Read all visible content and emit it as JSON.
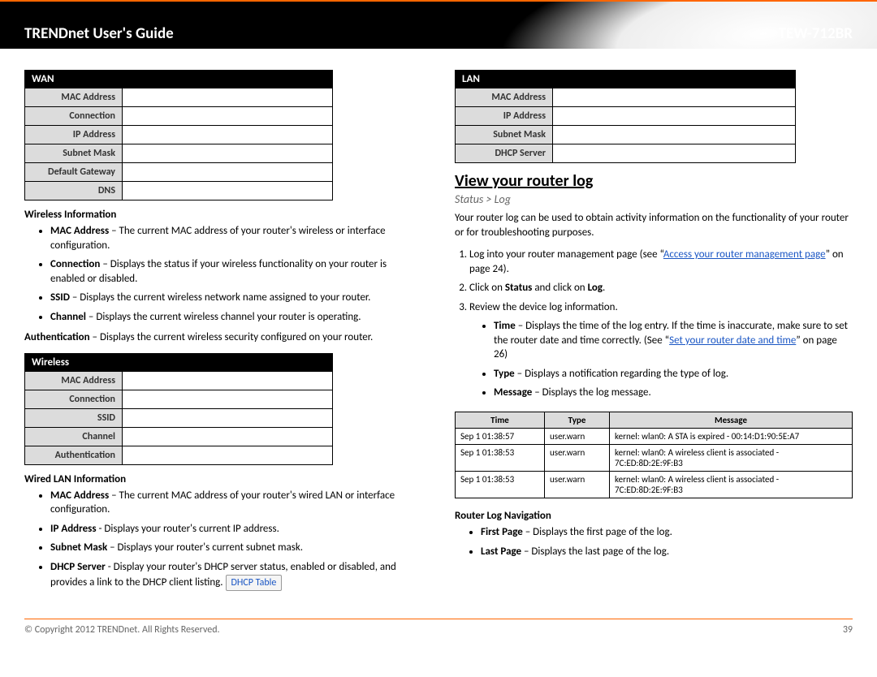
{
  "header": {
    "left": "TRENDnet User's Guide",
    "right": "TEW-712BR"
  },
  "left": {
    "wan_table": {
      "title": "WAN",
      "rows": [
        "MAC Address",
        "Connection",
        "IP Address",
        "Subnet Mask",
        "Default Gateway",
        "DNS"
      ]
    },
    "wireless_info": {
      "heading": "Wireless Information",
      "items": [
        {
          "label": "MAC Address",
          "text": " – The current MAC address of your router's wireless or interface configuration."
        },
        {
          "label": "Connection",
          "text": " – Displays the status if your wireless functionality on your router is enabled or disabled."
        },
        {
          "label": "SSID",
          "text": " – Displays the current wireless network name assigned to your router."
        },
        {
          "label": "Channel",
          "text": " – Displays the current wireless channel your router is operating."
        }
      ],
      "auth_label": "Authentication",
      "auth_text": " – Displays the current wireless security configured on your router."
    },
    "wireless_table": {
      "title": "Wireless",
      "rows": [
        "MAC Address",
        "Connection",
        "SSID",
        "Channel",
        "Authentication"
      ]
    },
    "wired_info": {
      "heading": "Wired LAN Information",
      "items": [
        {
          "label": "MAC Address",
          "text": " – The current MAC address of your router's wired LAN or interface configuration."
        },
        {
          "label": "IP Address",
          "text": " - Displays your router's current IP address."
        },
        {
          "label": "Subnet Mask",
          "text": " – Displays your router's current subnet mask."
        },
        {
          "label": "DHCP Server",
          "text": " - Display your router's DHCP server status, enabled or disabled, and provides a link to the DHCP client listing.  ",
          "chip": "DHCP Table"
        }
      ]
    }
  },
  "right": {
    "lan_table": {
      "title": "LAN",
      "rows": [
        "MAC Address",
        "IP Address",
        "Subnet Mask",
        "DHCP Server"
      ]
    },
    "section_title": "View your router log",
    "crumb": "Status > Log",
    "intro": "Your router log can be used to obtain activity information on the functionality of your router or for troubleshooting purposes.",
    "steps": {
      "s1_pre": "Log into your router management page (see “",
      "s1_link": "Access your router management page",
      "s1_post": "” on page 24).",
      "s2_a": "Click on ",
      "s2_b": "Status",
      "s2_c": " and click on ",
      "s2_d": "Log",
      "s2_e": ".",
      "s3": "Review the device log information."
    },
    "log_fields": [
      {
        "label": "Time",
        "text_a": " – Displays the time of the log entry. If the time is inaccurate, make sure to set the router date and time correctly. (See “",
        "link": "Set your router date and time",
        "text_b": "” on page 26)"
      },
      {
        "label": "Type",
        "text_a": " – Displays a notification regarding the type of log."
      },
      {
        "label": "Message",
        "text_a": " – Displays the log message."
      }
    ],
    "log_table": {
      "headers": [
        "Time",
        "Type",
        "Message"
      ],
      "rows": [
        [
          "Sep 1 01:38:57",
          "user.warn",
          "kernel: wlan0: A STA is expired - 00:14:D1:90:5E:A7"
        ],
        [
          "Sep 1 01:38:53",
          "user.warn",
          "kernel: wlan0: A wireless client is associated - 7C:ED:8D:2E:9F:B3"
        ],
        [
          "Sep 1 01:38:53",
          "user.warn",
          "kernel: wlan0: A wireless client is associated - 7C:ED:8D:2E:9F:B3"
        ]
      ]
    },
    "nav": {
      "heading": "Router Log Navigation",
      "items": [
        {
          "label": "First Page",
          "text": " – Displays the first page of the log."
        },
        {
          "label": "Last Page",
          "text": " – Displays the last page of the log."
        }
      ]
    }
  },
  "footer": {
    "copyright": "© Copyright 2012 TRENDnet. All Rights Reserved.",
    "page": "39"
  }
}
